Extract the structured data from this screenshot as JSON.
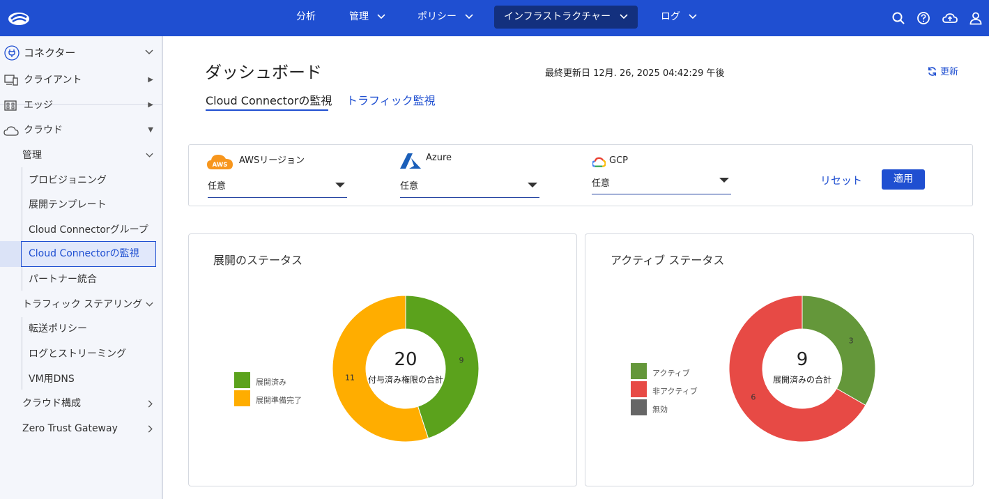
{
  "topnav": {
    "items": [
      {
        "label": "分析",
        "chevron": false
      },
      {
        "label": "管理",
        "chevron": true
      },
      {
        "label": "ポリシー",
        "chevron": true
      },
      {
        "label": "インフラストラクチャー",
        "chevron": true,
        "active": true
      },
      {
        "label": "ログ",
        "chevron": true
      }
    ],
    "icons": [
      "search-icon",
      "help-icon",
      "cloud-upload-icon",
      "user-icon"
    ]
  },
  "sidebar": {
    "header": "コネクター",
    "client": "クライアント",
    "edge": "エッジ",
    "cloud": "クラウド",
    "manage": "管理",
    "provisioning": "プロビジョニング",
    "deploy_template": "展開テンプレート",
    "cc_group": "Cloud Connectorグループ",
    "cc_monitor": "Cloud Connectorの監視",
    "partner": "パートナー統合",
    "traffic_steering": "トラフィック ステアリング",
    "forwarding_policy": "転送ポリシー",
    "log_streaming": "ログとストリーミング",
    "vm_dns": "VM用DNS",
    "cloud_config": "クラウド構成",
    "ztg": "Zero Trust Gateway"
  },
  "main": {
    "title": "ダッシュボード",
    "updated": "最終更新日 12月. 26, 2025 04:42:29 午後",
    "refresh": "更新",
    "tabs": [
      "Cloud Connectorの監視",
      "トラフィック監視"
    ]
  },
  "filters": {
    "aws": {
      "label": "AWSリージョン",
      "value": "任意",
      "badge": "AWS"
    },
    "azure": {
      "label": "Azure",
      "value": "任意"
    },
    "gcp": {
      "label": "GCP",
      "value": "任意"
    },
    "reset": "リセット",
    "apply": "適用"
  },
  "colors": {
    "accent": "#1f4fd1",
    "deployed": "#5ba21c",
    "pending": "#ffad00",
    "active": "#64973a",
    "inactive": "#e74a45",
    "disabled": "#666666"
  },
  "chart_data": [
    {
      "type": "pie",
      "title": "展開のステータス",
      "center_value": "20",
      "center_label": "付与済み権限の合計",
      "categories": [
        "展開済み",
        "展開準備完了"
      ],
      "values": [
        9,
        11
      ],
      "value_labels": [
        "9",
        "11"
      ],
      "legend": "left"
    },
    {
      "type": "pie",
      "title": "アクティブ ステータス",
      "center_value": "9",
      "center_label": "展開済みの合計",
      "categories": [
        "アクティブ",
        "非アクティブ",
        "無効"
      ],
      "values": [
        3,
        6,
        0
      ],
      "value_labels": [
        "3",
        "6",
        ""
      ],
      "legend": "left"
    }
  ]
}
